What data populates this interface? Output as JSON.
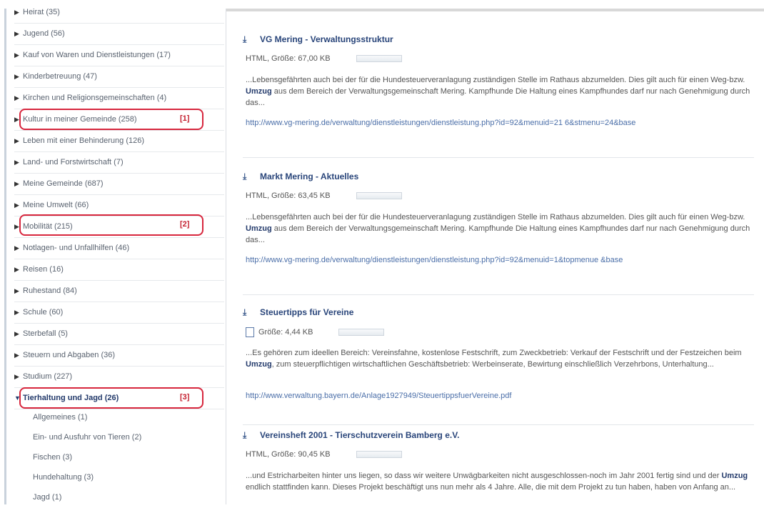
{
  "sidebar": {
    "categories": [
      {
        "label": "Heirat (35)"
      },
      {
        "label": "Jugend (56)"
      },
      {
        "label": "Kauf von Waren und Dienstleistungen (17)"
      },
      {
        "label": "Kinderbetreuung (47)"
      },
      {
        "label": "Kirchen und Religionsgemeinschaften (4)"
      },
      {
        "label": "Kultur in meiner Gemeinde (258)"
      },
      {
        "label": "Leben mit einer Behinderung (126)"
      },
      {
        "label": "Land- und Forstwirtschaft (7)"
      },
      {
        "label": "Meine Gemeinde (687)"
      },
      {
        "label": "Meine Umwelt (66)"
      },
      {
        "label": "Mobilität (215)"
      },
      {
        "label": "Notlagen- und Unfallhilfen (46)"
      },
      {
        "label": "Reisen (16)"
      },
      {
        "label": "Ruhestand (84)"
      },
      {
        "label": "Schule (60)"
      },
      {
        "label": "Sterbefall (5)"
      },
      {
        "label": "Steuern und Abgaben (36)"
      },
      {
        "label": "Studium (227)"
      },
      {
        "label": "Tierhaltung und Jagd (26)"
      }
    ],
    "subcategories": [
      {
        "label": "Allgemeines (1)"
      },
      {
        "label": "Ein- und Ausfuhr von Tieren (2)"
      },
      {
        "label": "Fischen (3)"
      },
      {
        "label": "Hundehaltung (3)"
      },
      {
        "label": "Jagd (1)"
      }
    ],
    "annotations": [
      "[1]",
      "[2]",
      "[3]"
    ]
  },
  "results": [
    {
      "title": "VG Mering - Verwaltungsstruktur",
      "meta": "HTML, Größe: 67,00 KB",
      "snippet_before": "...Lebensgefährten auch bei der für die Hundesteuerveranlagung zuständigen Stelle im Rathaus abzumelden. Dies gilt auch für einen Weg-bzw. ",
      "snippet_term": "Umzug",
      "snippet_after": " aus dem Bereich der Verwaltungsgemeinschaft Mering. Kampfhunde Die Haltung eines Kampfhundes darf nur nach Genehmigung durch das...",
      "url": "http://www.vg-mering.de/verwaltung/dienstleistungen/dienstleistung.php?id=92&menuid=21 6&stmenu=24&base"
    },
    {
      "title": "Markt Mering - Aktuelles",
      "meta": "HTML, Größe: 63,45 KB",
      "snippet_before": "...Lebensgefährten auch bei der für die Hundesteuerveranlagung zuständigen Stelle im Rathaus abzumelden. Dies gilt auch für einen Weg-bzw. ",
      "snippet_term": "Umzug",
      "snippet_after": " aus dem Bereich der Verwaltungsgemeinschaft Mering. Kampfhunde Die Haltung eines Kampfhundes darf nur nach Genehmigung durch das...",
      "url": "http://www.vg-mering.de/verwaltung/dienstleistungen/dienstleistung.php?id=92&menuid=1&topmenue &base"
    },
    {
      "title": "Steuertipps für Vereine",
      "meta": "Größe: 4,44 KB",
      "snippet_before": "...Es gehören zum ideellen Bereich: Vereinsfahne, kostenlose Festschrift, zum Zweckbetrieb: Verkauf der Festschrift und der Festzeichen beim ",
      "snippet_term": "Umzug",
      "snippet_after": ", zum steuerpflichtigen wirtschaftlichen Geschäftsbetrieb: Werbeinserate, Bewirtung einschließlich Verzehrbons, Unterhaltung...",
      "url": "http://www.verwaltung.bayern.de/Anlage1927949/SteuertippsfuerVereine.pdf"
    },
    {
      "title": "Vereinsheft 2001 - Tierschutzverein Bamberg e.V.",
      "meta": "HTML, Größe: 90,45 KB",
      "snippet_before": "...und Estricharbeiten hinter uns liegen, so dass wir weitere Unwägbarkeiten nicht ausgeschlossen-noch im Jahr 2001 fertig sind und der ",
      "snippet_term": "Umzug",
      "snippet_after": " endlich stattfinden kann. Dieses Projekt beschäftigt uns nun mehr als 4 Jahre. Alle, die mit dem Projekt zu tun haben, haben von Anfang an...",
      "url": ""
    }
  ]
}
